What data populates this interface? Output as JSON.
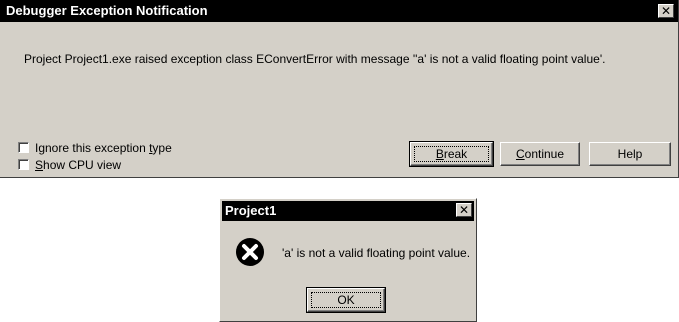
{
  "main_dialog": {
    "title": "Debugger Exception Notification",
    "close_glyph": "✕",
    "message": "Project Project1.exe raised exception class EConvertError with message ''a' is not a valid floating point value'.",
    "checkboxes": [
      {
        "label_pre": "Ignore this exception ",
        "label_key": "t",
        "label_post": "ype",
        "checked": false
      },
      {
        "label_pre": "",
        "label_key": "S",
        "label_post": "how CPU view",
        "checked": false
      }
    ],
    "buttons": {
      "break": {
        "key": "B",
        "rest": "reak"
      },
      "continue": {
        "key": "C",
        "rest": "ontinue"
      },
      "help": {
        "label": "Help"
      }
    }
  },
  "message_box": {
    "title": "Project1",
    "close_glyph": "✕",
    "icon": "error-icon",
    "message": "'a' is not a valid floating point value.",
    "ok_label": "OK"
  },
  "colors": {
    "dialog_face": "#d4d0c8",
    "titlebar": "#000000",
    "error_icon": "#000000"
  }
}
